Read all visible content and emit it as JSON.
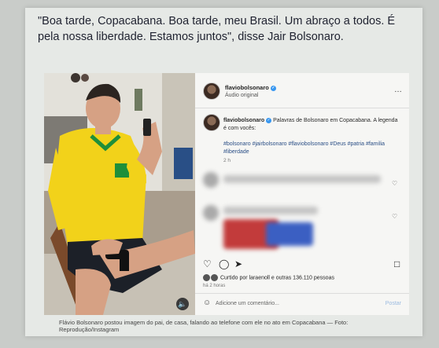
{
  "article": {
    "quote": "\"Boa tarde, Copacabana. Boa tarde, meu Brasil. Um abraço a todos. É pela nossa liberdade. Estamos juntos\", disse Jair Bolsonaro.",
    "credit": "Flávio Bolsonaro postou imagem do pai, de casa, falando ao telefone com ele no ato em Copacabana — Foto: Reprodução/Instagram"
  },
  "post": {
    "username": "flaviobolsonaro",
    "audio": "Áudio original",
    "more_icon": "more-icon",
    "caption_user": "flaviobolsonaro",
    "caption": "Palavras de Bolsonaro em Copacabana. A legenda é com vocês:",
    "hashtags": "#bolsonaro #jairbolsonaro #flaviobolsonaro #Deus #patria #familia #liberdade",
    "time": "2 h",
    "likes": "Curtido por laraenoll e outras 136.110 pessoas",
    "ago": "há 2 horas",
    "comment_placeholder": "Adicione um comentário...",
    "post_button": "Postar",
    "icons": {
      "like": "heart-icon",
      "comment": "comment-icon",
      "share": "share-icon",
      "save": "bookmark-icon",
      "emoji": "emoji-icon",
      "mute": "mute-icon"
    },
    "colors": {
      "link": "#2b4f86",
      "verified": "#3897f0",
      "shirt": "#f2d21a",
      "shirt_trim": "#1f8f3a"
    }
  }
}
